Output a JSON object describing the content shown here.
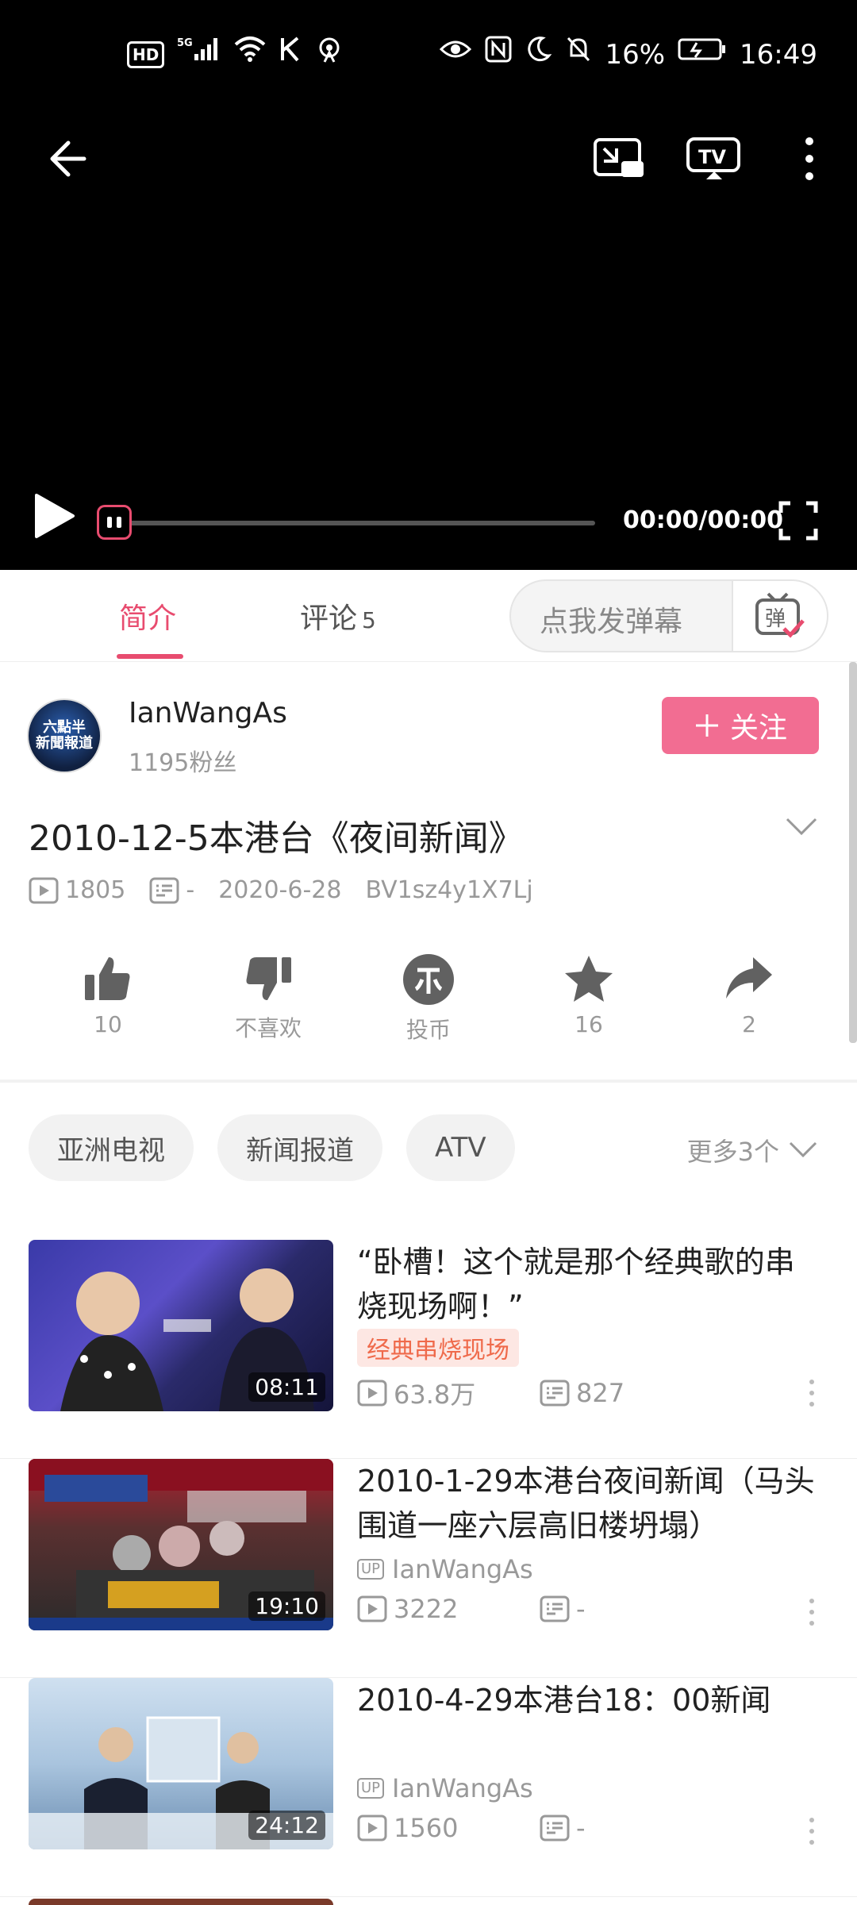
{
  "status_bar": {
    "left_icons": [
      "hd-icon",
      "5g-icon",
      "signal-icon",
      "wifi-icon",
      "k-icon",
      "hotspot-icon"
    ],
    "hd": "HD",
    "battery": "16%",
    "time": "16:49"
  },
  "player": {
    "time": "00:00/00:00",
    "progress": 0
  },
  "tabs": {
    "intro": "简介",
    "comments": "评论",
    "comments_count": "5",
    "danmaku_placeholder": "点我发弹幕",
    "danmaku_btn": "弹"
  },
  "uploader": {
    "avatar_text": "六點半\n新聞報道",
    "name": "IanWangAs",
    "fans": "1195粉丝",
    "follow": "关注"
  },
  "video": {
    "title": "2010-12-5本港台《夜间新闻》",
    "views": "1805",
    "danmaku": "-",
    "date": "2020-6-28",
    "bvid": "BV1sz4y1X7Lj"
  },
  "actions": [
    {
      "label": "10"
    },
    {
      "label": "不喜欢"
    },
    {
      "label": "投币"
    },
    {
      "label": "16"
    },
    {
      "label": "2"
    }
  ],
  "tags": [
    "亚洲电视",
    "新闻报道",
    "ATV"
  ],
  "more_tags": "更多3个",
  "recommendations": [
    {
      "title": "“卧槽！这个就是那个经典歌的串烧现场啊！”",
      "badge": "经典串烧现场",
      "duration": "08:11",
      "views": "63.8万",
      "danmaku": "827"
    },
    {
      "title": "2010-1-29本港台夜间新闻（马头围道一座六层高旧楼坍塌）",
      "up": "UP",
      "owner": "IanWangAs",
      "duration": "19:10",
      "views": "3222",
      "danmaku": "-"
    },
    {
      "title": "2010-4-29本港台18：00新闻",
      "up": "UP",
      "owner": "IanWangAs",
      "duration": "24:12",
      "views": "1560",
      "danmaku": "-"
    }
  ],
  "colors": {
    "accent": "#e84c6f",
    "follow_bg": "#f26d92"
  }
}
